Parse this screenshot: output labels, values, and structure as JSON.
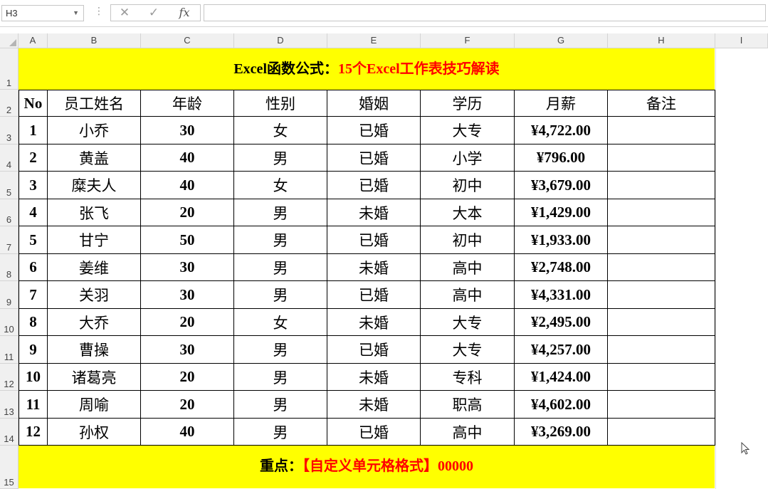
{
  "name_box": "H3",
  "formula_bar": {
    "cancel_icon": "✕",
    "enter_icon": "✓",
    "fx_label": "fx",
    "value": ""
  },
  "columns": [
    "A",
    "B",
    "C",
    "D",
    "E",
    "F",
    "G",
    "H",
    "I"
  ],
  "rows": [
    "1",
    "2",
    "3",
    "4",
    "5",
    "6",
    "7",
    "8",
    "9",
    "10",
    "11",
    "12",
    "13",
    "14",
    "15"
  ],
  "title": {
    "black": "Excel函数公式：",
    "red": "15个Excel工作表技巧解读"
  },
  "table": {
    "headers": [
      "No",
      "员工姓名",
      "年龄",
      "性别",
      "婚姻",
      "学历",
      "月薪",
      "备注"
    ],
    "rows": [
      [
        "1",
        "小乔",
        "30",
        "女",
        "已婚",
        "大专",
        "¥4,722.00",
        ""
      ],
      [
        "2",
        "黄盖",
        "40",
        "男",
        "已婚",
        "小学",
        "¥796.00",
        ""
      ],
      [
        "3",
        "糜夫人",
        "40",
        "女",
        "已婚",
        "初中",
        "¥3,679.00",
        ""
      ],
      [
        "4",
        "张飞",
        "20",
        "男",
        "未婚",
        "大本",
        "¥1,429.00",
        ""
      ],
      [
        "5",
        "甘宁",
        "50",
        "男",
        "已婚",
        "初中",
        "¥1,933.00",
        ""
      ],
      [
        "6",
        "姜维",
        "30",
        "男",
        "未婚",
        "高中",
        "¥2,748.00",
        ""
      ],
      [
        "7",
        "关羽",
        "30",
        "男",
        "已婚",
        "高中",
        "¥4,331.00",
        ""
      ],
      [
        "8",
        "大乔",
        "20",
        "女",
        "未婚",
        "大专",
        "¥2,495.00",
        ""
      ],
      [
        "9",
        "曹操",
        "30",
        "男",
        "已婚",
        "大专",
        "¥4,257.00",
        ""
      ],
      [
        "10",
        "诸葛亮",
        "20",
        "男",
        "未婚",
        "专科",
        "¥1,424.00",
        ""
      ],
      [
        "11",
        "周喻",
        "20",
        "男",
        "未婚",
        "职高",
        "¥4,602.00",
        ""
      ],
      [
        "12",
        "孙权",
        "40",
        "男",
        "已婚",
        "高中",
        "¥3,269.00",
        ""
      ]
    ]
  },
  "footer": {
    "black": "重点：",
    "red": "【自定义单元格格式】00000"
  },
  "colors": {
    "banner_bg": "#ffff00",
    "red_text": "#ff0000",
    "header_bg": "#f0f0f0"
  }
}
